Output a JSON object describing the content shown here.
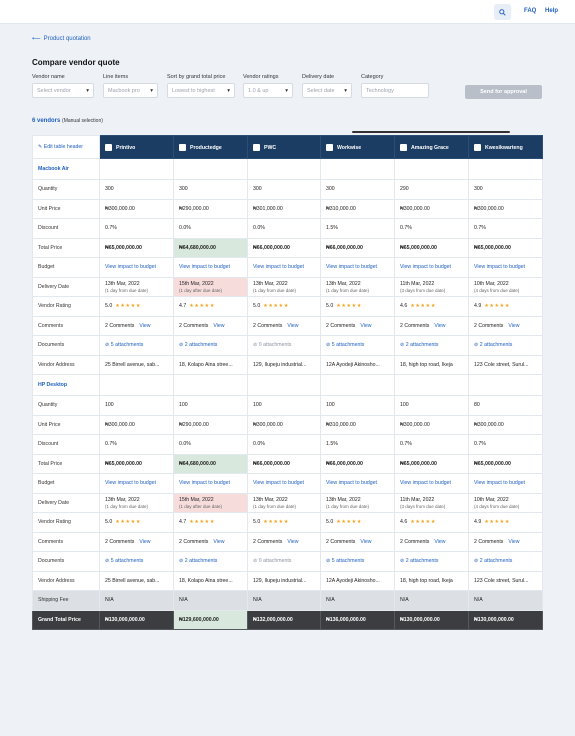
{
  "topbar": {
    "faq": "FAQ",
    "help": "Help"
  },
  "nav": {
    "back": "Product quotation"
  },
  "page": {
    "title": "Compare vendor quote"
  },
  "filters": [
    {
      "label": "Vendor name",
      "value": "Select vendor"
    },
    {
      "label": "Line items",
      "value": "Macbook pro"
    },
    {
      "label": "Sort by grand total price",
      "value": "Lowest to highest"
    },
    {
      "label": "Vendor ratings",
      "value": "1.0 & up"
    },
    {
      "label": "Delivery date",
      "value": "Select date"
    },
    {
      "label": "Category",
      "value": "Technology"
    }
  ],
  "actions": {
    "approve": "Send for approval"
  },
  "summary": {
    "count": "6 vendors",
    "note": "(Manual selection)"
  },
  "table": {
    "edit_header": "Edit table header",
    "vendors": [
      "Printivo",
      "Productedge",
      "PWC",
      "Workwise",
      "Amazing Grace",
      "Kwesikwarteng"
    ],
    "labels": {
      "quantity": "Quantity",
      "unit_price": "Unit Price",
      "discount": "Discount",
      "total_price": "Total Price",
      "budget": "Budget",
      "delivery_date": "Delivery Date",
      "vendor_rating": "Vendor Rating",
      "comments": "Comments",
      "documents": "Documents",
      "vendor_address": "Vendor Address",
      "shipping_fee": "Shipping Fee",
      "grand_total": "Grand Total Price"
    },
    "view_budget": "View impact to budget",
    "view": "View",
    "stars": "★★★★★",
    "sections": [
      {
        "name": "Macbook Air",
        "quantity": [
          "300",
          "300",
          "300",
          "300",
          "290",
          "300"
        ],
        "unit_price": [
          "₦300,000.00",
          "₦290,000.00",
          "₦301,000.00",
          "₦310,000.00",
          "₦300,000.00",
          "₦300,000.00"
        ],
        "discount": [
          "0.7%",
          "0.0%",
          "0.0%",
          "1.5%",
          "0.7%",
          "0.7%"
        ],
        "total_price": [
          "₦65,000,000.00",
          "₦64,680,000.00",
          "₦66,000,000.00",
          "₦66,000,000.00",
          "₦65,000,000.00",
          "₦65,000,000.00"
        ],
        "delivery_date": [
          "13th Mar, 2022",
          "15th Mar, 2022",
          "13th Mar, 2022",
          "13th Mar, 2022",
          "11th Mar, 2022",
          "10th Mar, 2022"
        ],
        "delivery_note": [
          "(1 day from due date)",
          "(1 day after due date)",
          "(1 day from due date)",
          "(1 day from due date)",
          "(3 days from due date)",
          "(4 days from due date)"
        ],
        "rating": [
          "5.0",
          "4.7",
          "5.0",
          "5.0",
          "4.6",
          "4.9"
        ],
        "comments": [
          "2 Comments",
          "2 Comments",
          "2 Comments",
          "2 Comments",
          "2 Comments",
          "2 Comments"
        ],
        "documents": [
          "5 attachments",
          "2 attachments",
          "0 attachments",
          "5 attachments",
          "2 attachments",
          "2 attachments"
        ],
        "address": [
          "25 Birrell avenue, sab...",
          "18, Kolapo Aina stree...",
          "129, Ilupeju industrial...",
          "12A Ayodeji Akinosho...",
          "18, high top road, Ikeja",
          "123 Cole street, Surul..."
        ]
      },
      {
        "name": "HP Desktop",
        "quantity": [
          "100",
          "100",
          "100",
          "100",
          "100",
          "80"
        ],
        "unit_price": [
          "₦300,000.00",
          "₦290,000.00",
          "₦300,000.00",
          "₦310,000.00",
          "₦300,000.00",
          "₦300,000.00"
        ],
        "discount": [
          "0.7%",
          "0.0%",
          "0.0%",
          "1.5%",
          "0.7%",
          "0.7%"
        ],
        "total_price": [
          "₦65,000,000.00",
          "₦64,680,000.00",
          "₦66,000,000.00",
          "₦66,000,000.00",
          "₦65,000,000.00",
          "₦65,000,000.00"
        ],
        "delivery_date": [
          "13th Mar, 2022",
          "15th Mar, 2022",
          "13th Mar, 2022",
          "13th Mar, 2022",
          "11th Mar, 2022",
          "10th Mar, 2022"
        ],
        "delivery_note": [
          "(1 day from due date)",
          "(1 day after due date)",
          "(1 day from due date)",
          "(1 day from due date)",
          "(3 days from due date)",
          "(4 days from due date)"
        ],
        "rating": [
          "5.0",
          "4.7",
          "5.0",
          "5.0",
          "4.6",
          "4.9"
        ],
        "comments": [
          "2 Comments",
          "2 Comments",
          "2 Comments",
          "2 Comments",
          "2 Comments",
          "2 Comments"
        ],
        "documents": [
          "5 attachments",
          "2 attachments",
          "0 attachments",
          "5 attachments",
          "2 attachments",
          "2 attachments"
        ],
        "address": [
          "25 Birrell avenue, sab...",
          "18, Kolapo Aina stree...",
          "129, Ilupeju industrial...",
          "12A Ayodeji Akinosho...",
          "18, high top road, Ikeja",
          "123 Cole street, Surul..."
        ]
      }
    ],
    "shipping": [
      "N/A",
      "N/A",
      "N/A",
      "N/A",
      "N/A",
      "N/A"
    ],
    "grand_total": [
      "₦130,000,000.00",
      "₦129,600,000.00",
      "₦132,000,000.00",
      "₦136,000,000.00",
      "₦130,000,000.00",
      "₦130,000,000.00"
    ],
    "best_index": 1,
    "late_index": 1,
    "empty_doc_index": 2
  },
  "colors": {
    "header": "#1c3d63",
    "accent": "#1f5fbf",
    "best": "#d9e8dc",
    "late": "#f7dcdc",
    "star": "#f2a21a"
  }
}
